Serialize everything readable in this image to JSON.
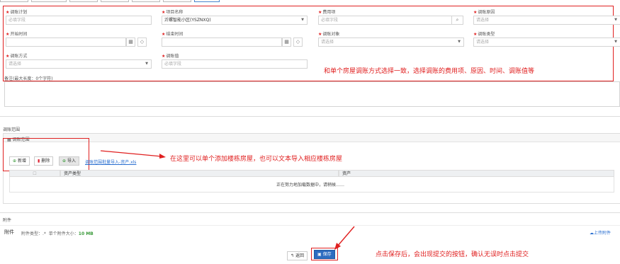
{
  "form": {
    "plan": {
      "label": "调账计划",
      "required": true,
      "placeholder": "必填字段"
    },
    "project": {
      "label": "项目名称",
      "required": true,
      "value": "沂螺智能小区(YSZNXQ)"
    },
    "fee_item": {
      "label": "费用项",
      "required": true,
      "placeholder": "必填字段"
    },
    "reason": {
      "label": "调账原因",
      "required": true,
      "placeholder": "请选择"
    },
    "start_time": {
      "label": "开始时间",
      "required": true
    },
    "end_time": {
      "label": "结束时间",
      "required": true
    },
    "target": {
      "label": "调账对象",
      "required": true,
      "placeholder": "请选择"
    },
    "adjust_type": {
      "label": "调账类型",
      "required": true,
      "placeholder": "请选择"
    },
    "method": {
      "label": "调账方式",
      "required": true,
      "placeholder": "请选择"
    },
    "amount": {
      "label": "调账值",
      "required": true,
      "placeholder": "必填字段"
    },
    "remark_label": "备注(最大长度：0个字符)"
  },
  "annotations": {
    "form_note": "和单个房屋调账方式选择一致，选择调账的费用项、原因、时间、调账值等",
    "range_note": "在这里可以单个添加楼栋房屋，也可以文本导入相应楼栋房屋",
    "save_note": "点击保存后，会出现提交的按钮，确认无误时点击提交"
  },
  "range_section": {
    "title": "调账范围",
    "panel_title": "调账范围",
    "add_label": "新增",
    "delete_label": "删除",
    "import_label": "导入",
    "template_link": "调账范围批量导入-资产.xls",
    "columns": [
      "资产类型",
      "资产"
    ],
    "loading_text": "正在努力地加载数据中，请稍候……"
  },
  "attachments": {
    "title": "附件",
    "label": "附件",
    "type_text": "附件类型：.*",
    "size_text": "单个附件大小：",
    "size_value": "10 MB",
    "upload_label": "上传附件"
  },
  "footer": {
    "back_label": "返回",
    "save_label": "保存"
  },
  "colors": {
    "required": "#e02020",
    "annotation": "#e02020",
    "primary": "#2d6cc0",
    "link": "#2a6fd0",
    "success_icon": "#3a9a3a"
  }
}
